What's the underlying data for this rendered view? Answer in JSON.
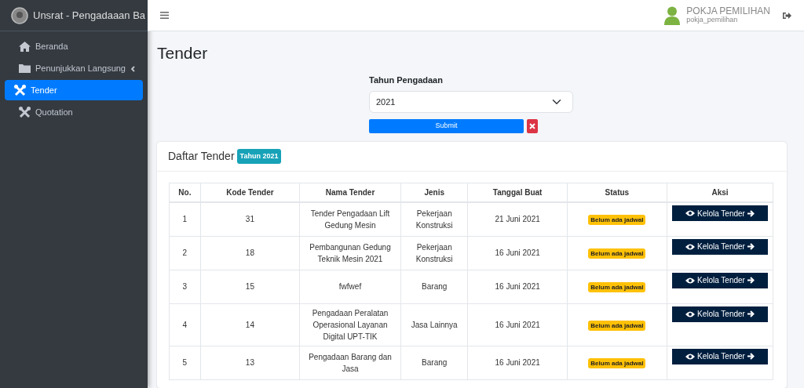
{
  "brand": {
    "title": "Unsrat - Pengadaaan Ba"
  },
  "sidebar": {
    "items": [
      {
        "label": "Beranda",
        "selected": false,
        "submenu": false
      },
      {
        "label": "Penunjukkan Langsung",
        "selected": false,
        "submenu": true
      },
      {
        "label": "Tender",
        "selected": true,
        "submenu": false
      },
      {
        "label": "Quotation",
        "selected": false,
        "submenu": false
      }
    ]
  },
  "user": {
    "name": "POKJA PEMILIHAN",
    "username": "pokja_pemilihan"
  },
  "page_title": "Tender",
  "filter": {
    "label": "Tahun Pengadaan",
    "value": "2021",
    "submit": "Submit"
  },
  "card": {
    "title": "Daftar Tender",
    "badge": "Tahun 2021"
  },
  "table": {
    "columns": [
      "No.",
      "Kode Tender",
      "Nama Tender",
      "Jenis",
      "Tanggal Buat",
      "Status",
      "Aksi"
    ],
    "rows": [
      {
        "no": "1",
        "kode": "31",
        "nama": "Tender Pengadaan Lift Gedung Mesin",
        "jenis": "Pekerjaan Konstruksi",
        "tanggal": "21 Juni 2021",
        "status": "Belum ada jadwal",
        "action": "Kelola Tender"
      },
      {
        "no": "2",
        "kode": "18",
        "nama": "Pembangunan Gedung Teknik Mesin 2021",
        "jenis": "Pekerjaan Konstruksi",
        "tanggal": "16 Juni 2021",
        "status": "Belum ada jadwal",
        "action": "Kelola Tender"
      },
      {
        "no": "3",
        "kode": "15",
        "nama": "fwfwef",
        "jenis": "Barang",
        "tanggal": "16 Juni 2021",
        "status": "Belum ada jadwal",
        "action": "Kelola Tender"
      },
      {
        "no": "4",
        "kode": "14",
        "nama": "Pengadaan Peralatan Operasional Layanan Digital UPT-TIK",
        "jenis": "Jasa Lainnya",
        "tanggal": "16 Juni 2021",
        "status": "Belum ada jadwal",
        "action": "Kelola Tender"
      },
      {
        "no": "5",
        "kode": "13",
        "nama": "Pengadaan Barang dan Jasa",
        "jenis": "Barang",
        "tanggal": "16 Juni 2021",
        "status": "Belum ada jadwal",
        "action": "Kelola Tender"
      }
    ]
  }
}
